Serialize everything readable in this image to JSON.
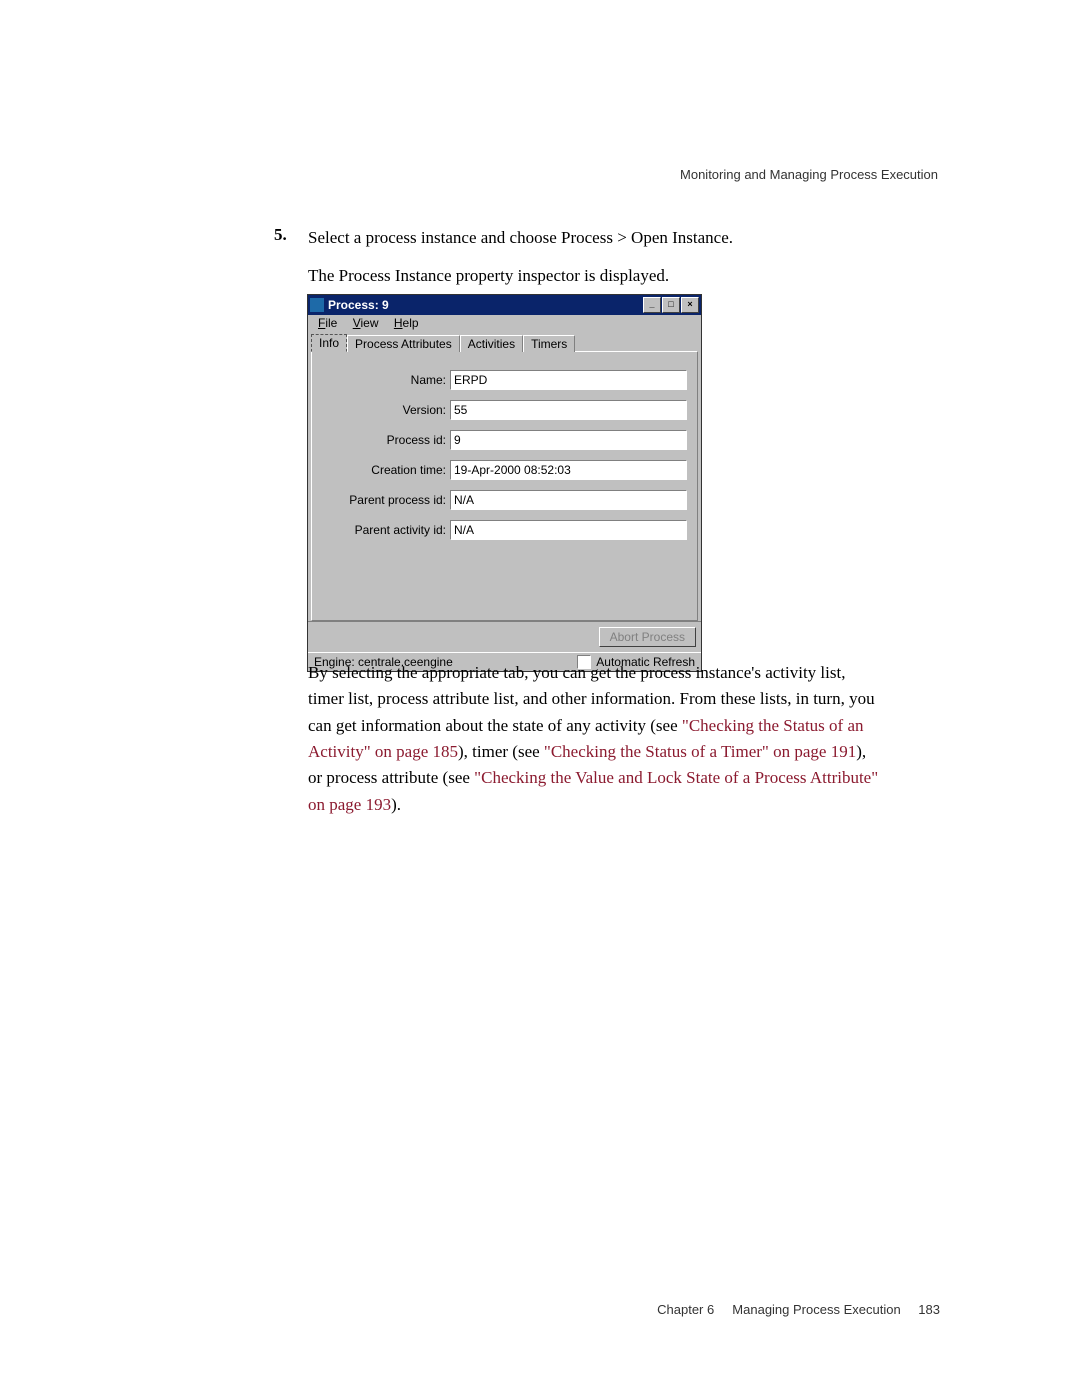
{
  "header": {
    "text": "Monitoring and Managing Process Execution"
  },
  "step": {
    "number": "5.",
    "line1": "Select a process instance and choose Process > Open Instance.",
    "line2": "The Process Instance property inspector is displayed."
  },
  "window": {
    "title": "Process: 9",
    "menus": {
      "file": "File",
      "view": "View",
      "help": "Help"
    },
    "tabs": {
      "info": "Info",
      "attrs": "Process Attributes",
      "activities": "Activities",
      "timers": "Timers"
    },
    "form": {
      "name_label": "Name:",
      "name_value": "ERPD",
      "version_label": "Version:",
      "version_value": "55",
      "pid_label": "Process id:",
      "pid_value": "9",
      "ctime_label": "Creation time:",
      "ctime_value": "19-Apr-2000 08:52:03",
      "ppid_label": "Parent process id:",
      "ppid_value": "N/A",
      "paid_label": "Parent activity id:",
      "paid_value": "N/A"
    },
    "abort_button": "Abort Process",
    "status_engine": "Engine: centrale.ceengine",
    "auto_refresh": "Automatic Refresh"
  },
  "paragraph": {
    "p1": "By selecting the appropriate tab, you can get the process instance's activity list, timer list, process attribute list, and other information. From these lists, in turn, you can get information about the state of any activity (see ",
    "link1": "\"Checking the Status of an Activity\" on page 185",
    "p2": "), timer (see ",
    "link2": "\"Checking the Status of a Timer\" on page 191",
    "p3": "), or process attribute (see ",
    "link3": "\"Checking the Value and Lock State of a Process Attribute\" on page 193",
    "p4": ")."
  },
  "footer": {
    "chapter": "Chapter    6",
    "title": "Managing Process Execution",
    "page": "183"
  }
}
